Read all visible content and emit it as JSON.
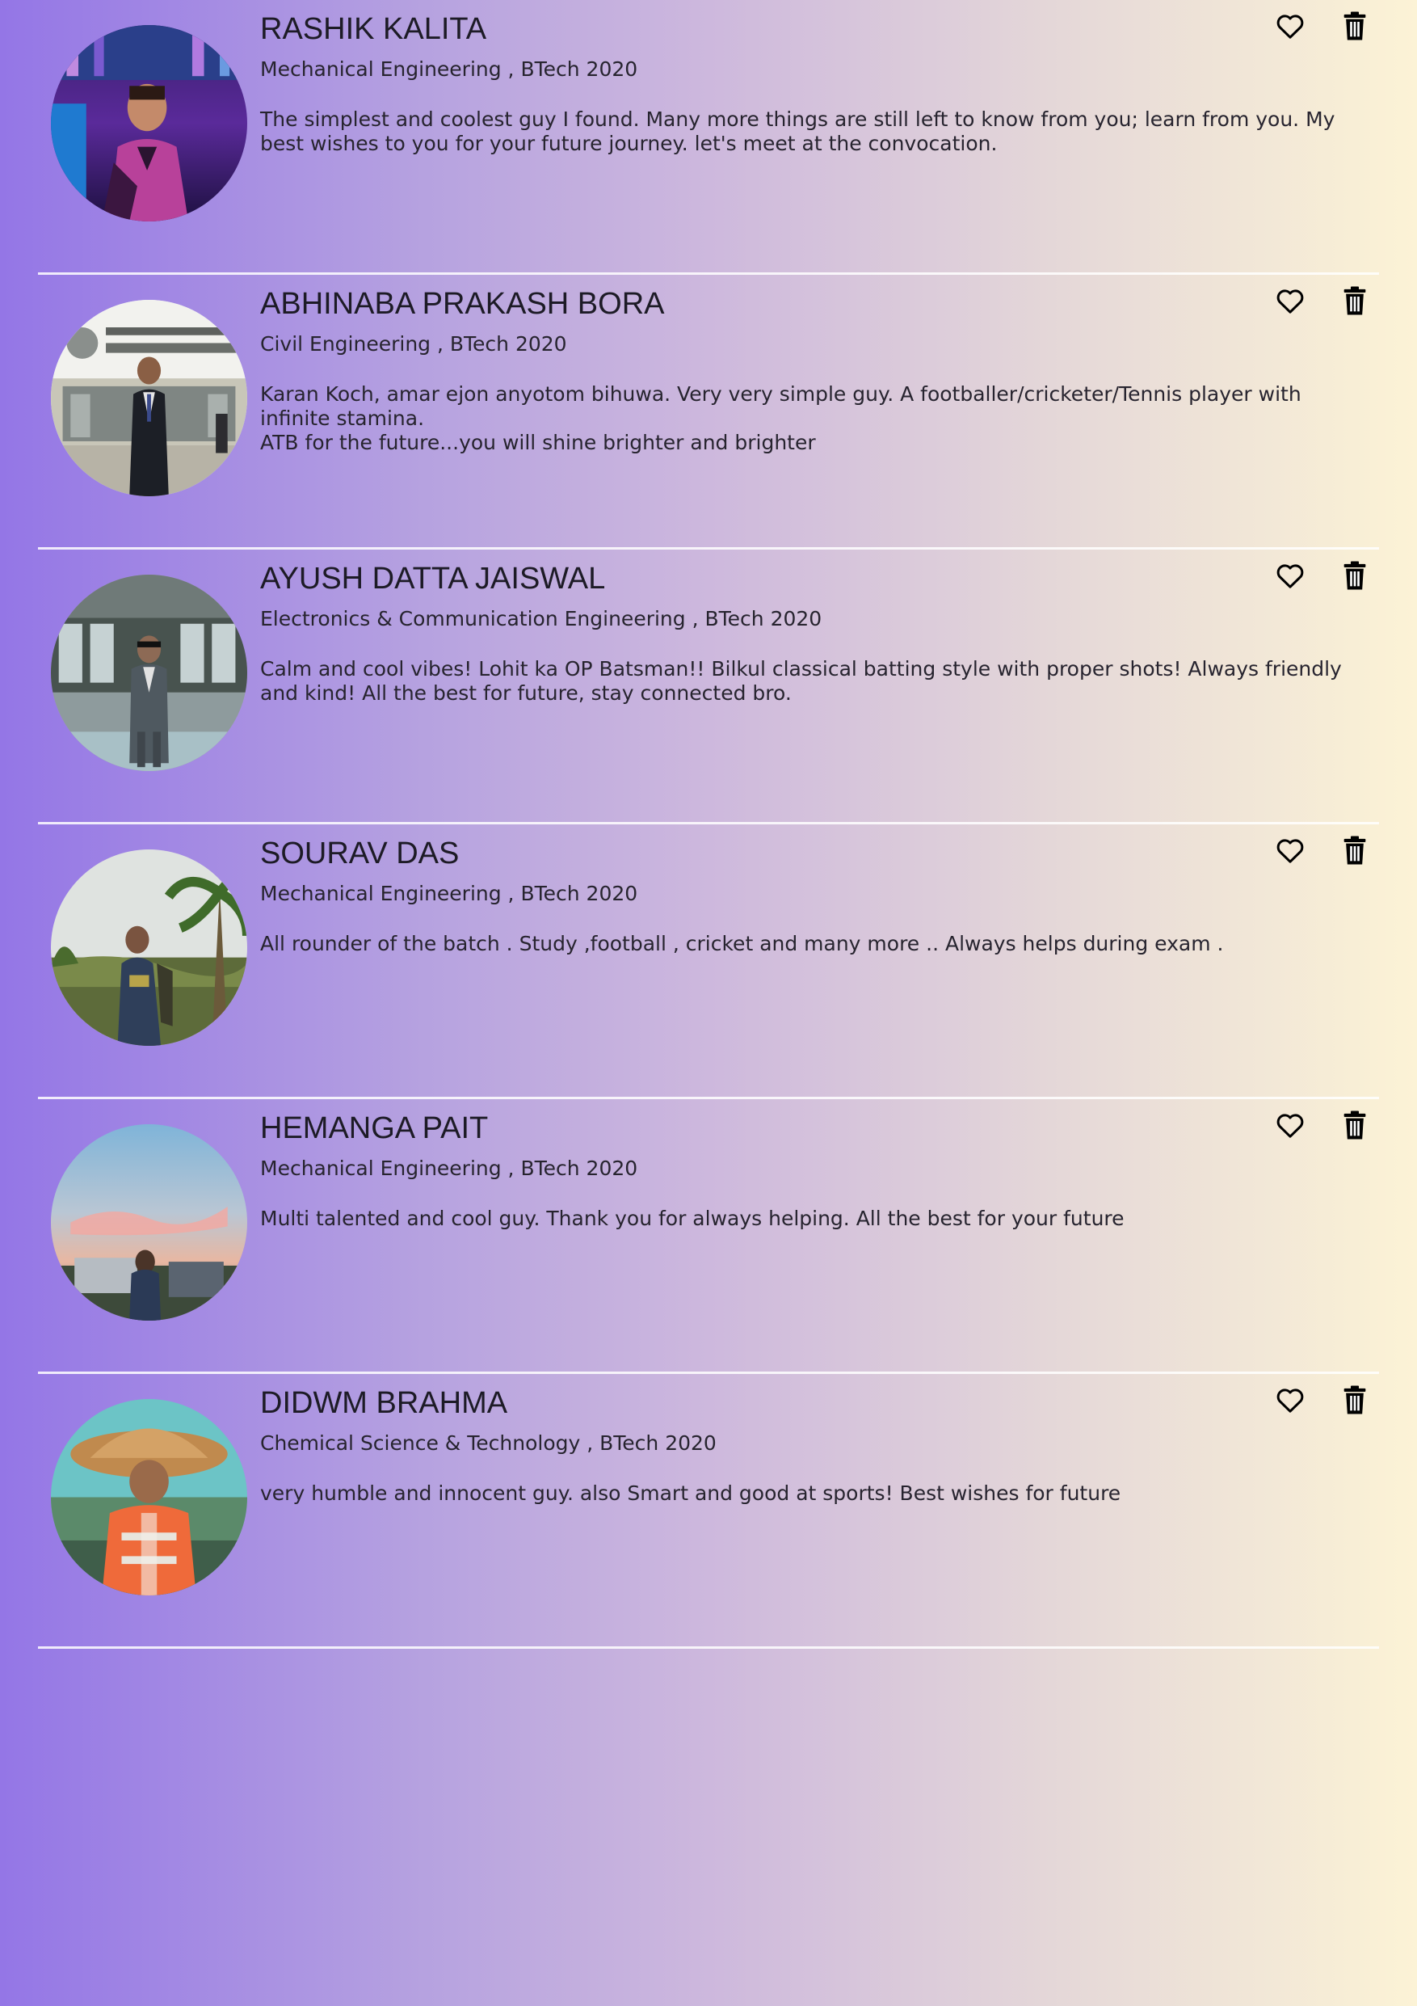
{
  "cards": [
    {
      "name": "RASHIK KALITA",
      "department": "Mechanical Engineering , BTech 2020",
      "message": "The simplest and coolest guy I found. Many more things are still left to know from you; learn from you. My best wishes to you for your future journey. let's meet at the convocation.",
      "photo": "photo-stage-purple"
    },
    {
      "name": "ABHINABA PRAKASH BORA",
      "department": "Civil Engineering , BTech 2020",
      "message": "Karan Koch, amar ejon anyotom bihuwa. Very very simple guy. A footballer/cricketer/Tennis player with infinite stamina.\nATB for the future...you will shine brighter and brighter",
      "photo": "photo-institute-building"
    },
    {
      "name": "AYUSH DATTA JAISWAL",
      "department": "Electronics & Communication Engineering , BTech 2020",
      "message": "Calm and cool vibes! Lohit ka OP Batsman!! Bilkul classical batting style with proper shots! Always friendly and kind! All the best for future, stay connected bro.",
      "photo": "photo-glass-building"
    },
    {
      "name": "SOURAV DAS",
      "department": "Mechanical Engineering , BTech 2020",
      "message": "All rounder of the batch . Study ,football , cricket and many more .. Always helps during exam .",
      "photo": "photo-palm-trees"
    },
    {
      "name": "HEMANGA PAIT",
      "department": "Mechanical Engineering , BTech 2020",
      "message": "Multi talented and cool guy. Thank you for always helping. All the best for your future",
      "photo": "photo-sunset-sky"
    },
    {
      "name": "DIDWM BRAHMA",
      "department": "Chemical Science & Technology , BTech 2020",
      "message": "very humble and innocent guy. also Smart and good at sports! Best wishes for future",
      "photo": "photo-straw-hat"
    }
  ],
  "icons": {
    "like": "heart-outline-icon",
    "delete": "trash-icon"
  },
  "colors": {
    "gradient_left": "#9476e6",
    "gradient_right": "#fcf3d6",
    "divider": "#ffffff",
    "icon": "#000000"
  }
}
